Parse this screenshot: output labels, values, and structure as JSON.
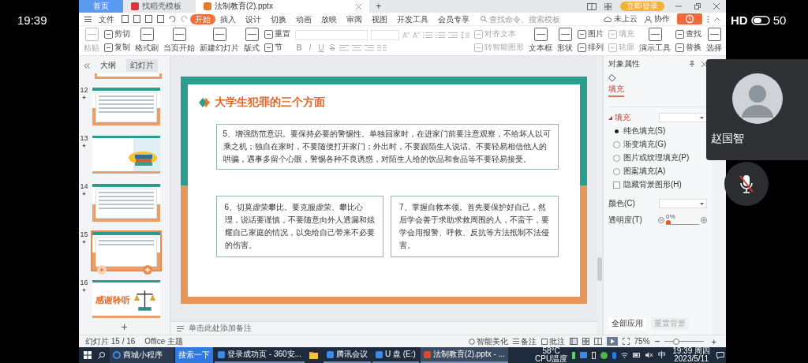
{
  "phone_status": {
    "time": "19:39",
    "network": "HD",
    "battery": "50"
  },
  "tabs": [
    {
      "label": "首页",
      "kind": "home",
      "selected": false
    },
    {
      "label": "找稻壳模板",
      "kind": "doc",
      "selected": false
    },
    {
      "label": "法制教育(2).pptx",
      "kind": "ppt",
      "selected": true
    }
  ],
  "new_tab": "+",
  "login_button": "立即登录",
  "menu": {
    "file": "文件",
    "items": [
      {
        "label": "开始",
        "selected": true
      },
      {
        "label": "插入",
        "selected": false
      },
      {
        "label": "设计",
        "selected": false
      },
      {
        "label": "切换",
        "selected": false
      },
      {
        "label": "动画",
        "selected": false
      },
      {
        "label": "放映",
        "selected": false
      },
      {
        "label": "审阅",
        "selected": false
      },
      {
        "label": "视图",
        "selected": false
      },
      {
        "label": "开发工具",
        "selected": false
      },
      {
        "label": "会员专享",
        "selected": false
      }
    ],
    "search": {
      "placeholder": "查找命令、搜索模板"
    },
    "cloud": "未上云",
    "collab": "协作"
  },
  "toolbar": [
    {
      "kind": "large",
      "items": [
        {
          "label": "粘贴",
          "disabled": true
        }
      ]
    },
    {
      "kind": "small",
      "items": [
        {
          "label": "剪切",
          "disabled": false
        },
        {
          "label": "复制",
          "disabled": false
        }
      ]
    },
    {
      "kind": "large",
      "items": [
        {
          "label": "格式刷",
          "disabled": false
        }
      ]
    },
    {
      "kind": "large",
      "items": [
        {
          "label": "当页开始",
          "disabled": false
        }
      ]
    },
    {
      "kind": "large",
      "items": [
        {
          "label": "新建幻灯片",
          "disabled": false
        }
      ]
    },
    {
      "kind": "large",
      "items": [
        {
          "label": "版式",
          "disabled": false
        }
      ]
    },
    {
      "kind": "small",
      "items": [
        {
          "label": "重置",
          "disabled": false
        },
        {
          "label": "节",
          "disabled": false
        }
      ]
    },
    {
      "kind": "font",
      "glyphs": [
        "B",
        "I",
        "U",
        "S"
      ]
    },
    {
      "kind": "small",
      "items": [
        {
          "label": "对齐文本",
          "disabled": true
        },
        {
          "label": "转智能图形",
          "disabled": true
        }
      ]
    },
    {
      "kind": "large",
      "items": [
        {
          "label": "文本框",
          "disabled": false
        }
      ]
    },
    {
      "kind": "large",
      "items": [
        {
          "label": "形状",
          "disabled": false
        }
      ]
    },
    {
      "kind": "small",
      "items": [
        {
          "label": "图片",
          "disabled": false
        },
        {
          "label": "排列",
          "disabled": false
        }
      ]
    },
    {
      "kind": "small",
      "items": [
        {
          "label": "填充",
          "disabled": true
        },
        {
          "label": "轮廓",
          "disabled": true
        }
      ]
    },
    {
      "kind": "large",
      "items": [
        {
          "label": "演示工具",
          "disabled": false
        }
      ]
    },
    {
      "kind": "small",
      "items": [
        {
          "label": "查找",
          "disabled": false
        },
        {
          "label": "替换",
          "disabled": false
        }
      ]
    },
    {
      "kind": "large",
      "items": [
        {
          "label": "选择",
          "disabled": false
        }
      ]
    }
  ],
  "slide_panel": {
    "tabs": [
      {
        "label": "大纲",
        "selected": false
      },
      {
        "label": "幻灯片",
        "selected": true
      }
    ],
    "slides": [
      {
        "number": "12",
        "kind": "text",
        "selected": false
      },
      {
        "number": "13",
        "kind": "cover",
        "selected": false
      },
      {
        "number": "14",
        "kind": "text",
        "selected": false
      },
      {
        "number": "15",
        "kind": "boxes",
        "selected": true
      },
      {
        "number": "16",
        "kind": "thanks",
        "title": "感谢聆听",
        "selected": false
      }
    ],
    "add_button": "+"
  },
  "slide": {
    "title": "大学生犯罪的三个方面",
    "boxes": [
      {
        "text": "5、增强防范意识。要保持必要的警惕性。单独回家时，在进家门前要注意观察，不给坏人以可乘之机；独自在家时，不要随便打开家门；外出时，不要跟陌生人说话。不要轻易相信他人的哄骗，遇事多留个心眼，警惕各种不良诱惑，对陌生人给的饮品和食品等不要轻易接受。"
      },
      {
        "text": "6、切莫虚荣攀比。要克服虚荣、攀比心理，说话要谨慎，不要随意向外人透漏和炫耀自己家庭的情况，以免给自己带来不必要的伤害。"
      },
      {
        "text": "7、掌握自救本领。首先要保护好自己，然后学会善于求助求救周围的人，不蛮干，要学会用报警、呼救、反抗等方法抵制不法侵害。"
      }
    ]
  },
  "notes_placeholder": "单击此处添加备注",
  "properties": {
    "title": "对象属性",
    "tab": "填充",
    "section": "填充",
    "options": [
      {
        "label": "纯色填充(S)",
        "kind": "radio",
        "selected": true
      },
      {
        "label": "渐变填充(G)",
        "kind": "radio",
        "selected": false
      },
      {
        "label": "图片或纹理填充(P)",
        "kind": "radio",
        "selected": false
      },
      {
        "label": "图案填充(A)",
        "kind": "radio",
        "selected": false
      },
      {
        "label": "隐藏背景图形(H)",
        "kind": "checkbox",
        "checked": false
      }
    ],
    "color_label": "颜色(C)",
    "transparency_label": "透明度(T)",
    "transparency_value": "0%",
    "transparency": {
      "level": 0
    },
    "buttons": [
      {
        "label": "全部应用",
        "disabled": false
      },
      {
        "label": "重置背景",
        "disabled": true
      }
    ]
  },
  "status_bar": {
    "slide_count": "幻灯片 15 / 16",
    "theme": "Office 主题",
    "beautify": "智能美化",
    "notes": "备注",
    "comments": "批注",
    "zoom": "75%",
    "zoom_slider": {
      "level": 0.3
    },
    "zoom_in": "+"
  },
  "taskbar": {
    "items": [
      {
        "label": "商城小程序",
        "kind": "browser",
        "selected": false
      },
      {
        "label": "搜索一下",
        "kind": "search",
        "selected": false
      },
      {
        "label": "登录成功页 - 360安...",
        "kind": "app",
        "selected": false
      },
      {
        "kind": "folder",
        "selected": false
      },
      {
        "label": "腾讯会议",
        "kind": "app",
        "selected": false
      },
      {
        "label": "U 盘 (E:)",
        "kind": "app",
        "selected": false
      },
      {
        "label": "法制教育(2).pptx - ...",
        "kind": "app",
        "selected": true
      }
    ],
    "temperature": "58°C",
    "temperature_label": "CPU温度",
    "ime": "中",
    "time": "19:39 周四",
    "date": "2023/5/11"
  },
  "participant": {
    "name": "赵国智",
    "muted": true
  }
}
